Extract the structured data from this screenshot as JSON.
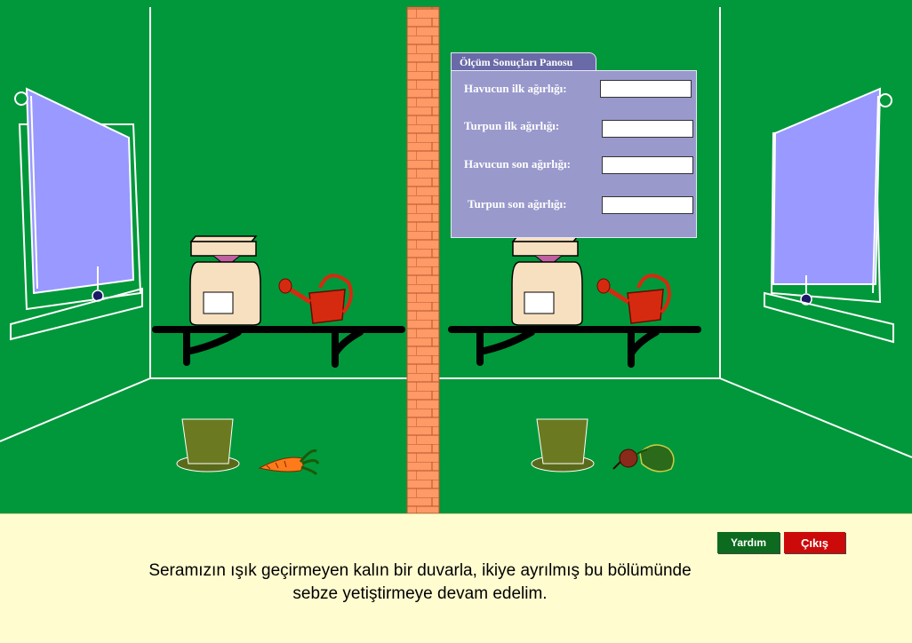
{
  "panel": {
    "title": "Ölçüm Sonuçları Panosu",
    "rows": [
      {
        "label": "Havucun ilk ağırlığı:",
        "value": ""
      },
      {
        "label": "Turpun ilk ağırlığı:",
        "value": ""
      },
      {
        "label": "Havucun son ağırlığı:",
        "value": ""
      },
      {
        "label": "Turpun son ağırlığı:",
        "value": ""
      }
    ]
  },
  "buttons": {
    "help": "Yardım",
    "exit": "Çıkış"
  },
  "message": {
    "line1": "Seramızın ışık geçirmeyen kalın bir duvarla, ikiye ayrılmış bu bölümünde",
    "line2": "sebze yetiştirmeye devam edelim."
  },
  "colors": {
    "scene_background": "#00983a",
    "brick": "#ff9966",
    "panel": "#9999cc",
    "window": "#9999ff",
    "help_button": "#0c6b1e",
    "exit_button": "#cc0a0a",
    "bottom_background": "#fffcd0"
  },
  "icons": [
    "window-blind-icon",
    "kitchen-scale-icon",
    "watering-can-icon",
    "flower-pot-icon",
    "carrot-icon",
    "radish-icon",
    "brick-wall-icon",
    "shelf-icon"
  ]
}
